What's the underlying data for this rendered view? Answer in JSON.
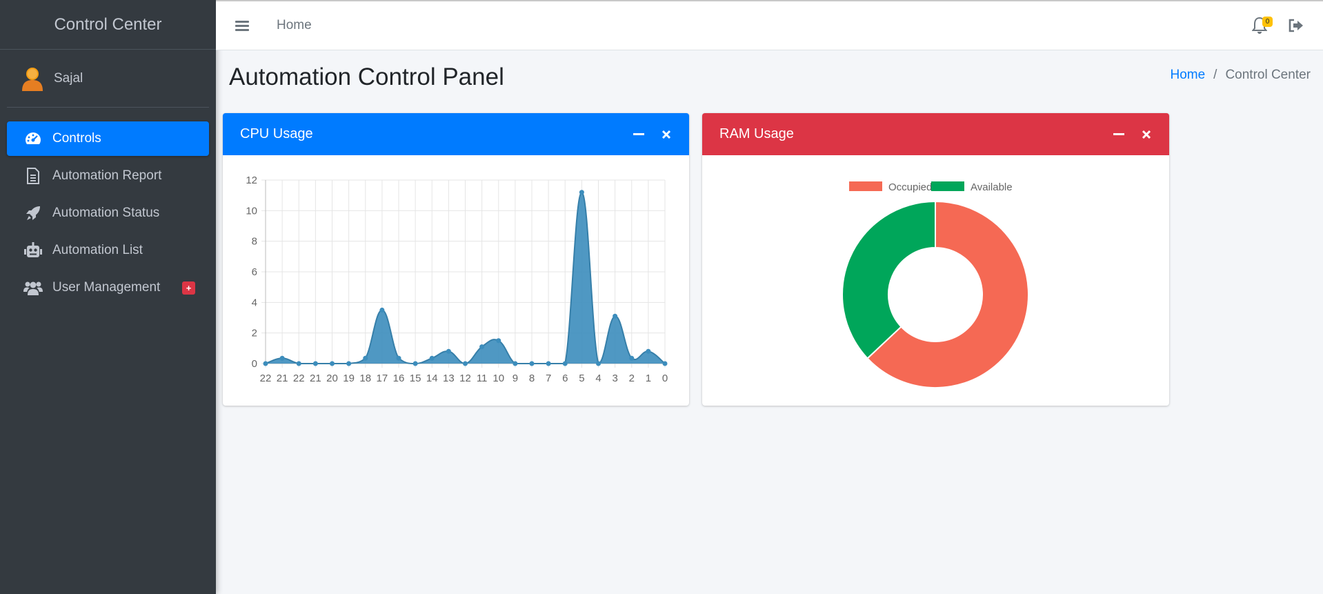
{
  "sidebar": {
    "brand": "Control Center",
    "user_name": "Sajal",
    "items": [
      {
        "label": "Controls",
        "icon": "gauge-icon",
        "active": true
      },
      {
        "label": "Automation Report",
        "icon": "file-text-icon"
      },
      {
        "label": "Automation Status",
        "icon": "rocket-icon"
      },
      {
        "label": "Automation List",
        "icon": "robot-icon"
      },
      {
        "label": "User Management",
        "icon": "users-icon",
        "badge": "+"
      }
    ]
  },
  "topbar": {
    "home_link": "Home",
    "notification_count": "0"
  },
  "page": {
    "title": "Automation Control Panel",
    "breadcrumb": {
      "home": "Home",
      "separator": "/",
      "current": "Control Center"
    }
  },
  "cpu_card": {
    "title": "CPU Usage",
    "color": "#007bff"
  },
  "ram_card": {
    "title": "RAM Usage",
    "color": "#dc3545"
  },
  "colors": {
    "sidebar_bg": "#343a40",
    "accent": "#007bff",
    "danger": "#dc3545",
    "warning": "#ffc107",
    "cpu_fill": "#3c8dbc",
    "ram_occupied": "#f56954",
    "ram_available": "#00a65a"
  },
  "chart_data": [
    {
      "type": "area",
      "categories": [
        "22",
        "21",
        "22",
        "21",
        "20",
        "19",
        "18",
        "17",
        "16",
        "15",
        "14",
        "13",
        "12",
        "11",
        "10",
        "9",
        "8",
        "7",
        "6",
        "5",
        "4",
        "3",
        "2",
        "1",
        "0"
      ],
      "series": [
        {
          "values": [
            0,
            0.35,
            0,
            0,
            0,
            0,
            0.35,
            3.5,
            0.35,
            0,
            0.35,
            0.8,
            0,
            1.1,
            1.5,
            0,
            0,
            0,
            0,
            11.2,
            0,
            3.1,
            0.35,
            0.8,
            0
          ]
        }
      ],
      "ylim": [
        0,
        12
      ],
      "yticks": [
        0,
        2,
        4,
        6,
        8,
        10,
        12
      ],
      "grid": true
    },
    {
      "type": "pie",
      "variant": "doughnut",
      "labels": [
        "Occupied",
        "Available"
      ],
      "values": [
        63,
        37
      ],
      "legend": "top"
    }
  ]
}
